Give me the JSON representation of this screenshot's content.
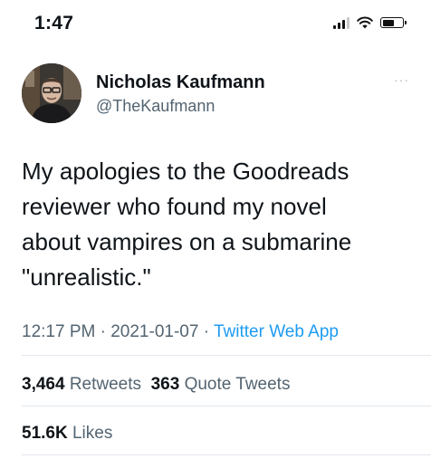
{
  "status_bar": {
    "time": "1:47"
  },
  "tweet": {
    "author_name": "Nicholas Kaufmann",
    "author_handle": "@TheKaufmann",
    "more": "···",
    "text": "My apologies to the Goodreads\nreviewer who found my novel\nabout vampires on a submarine\n\"unrealistic.\"",
    "time": "12:17 PM",
    "date": "2021-01-07",
    "separator": "·",
    "source": "Twitter Web App",
    "retweets_count": "3,464",
    "retweets_label": "Retweets",
    "quotes_count": "363",
    "quotes_label": "Quote Tweets",
    "likes_count": "51.6K",
    "likes_label": "Likes"
  },
  "colors": {
    "link": "#1d9bf0",
    "secondary_text": "#536471",
    "divider": "#e1e8ed"
  }
}
